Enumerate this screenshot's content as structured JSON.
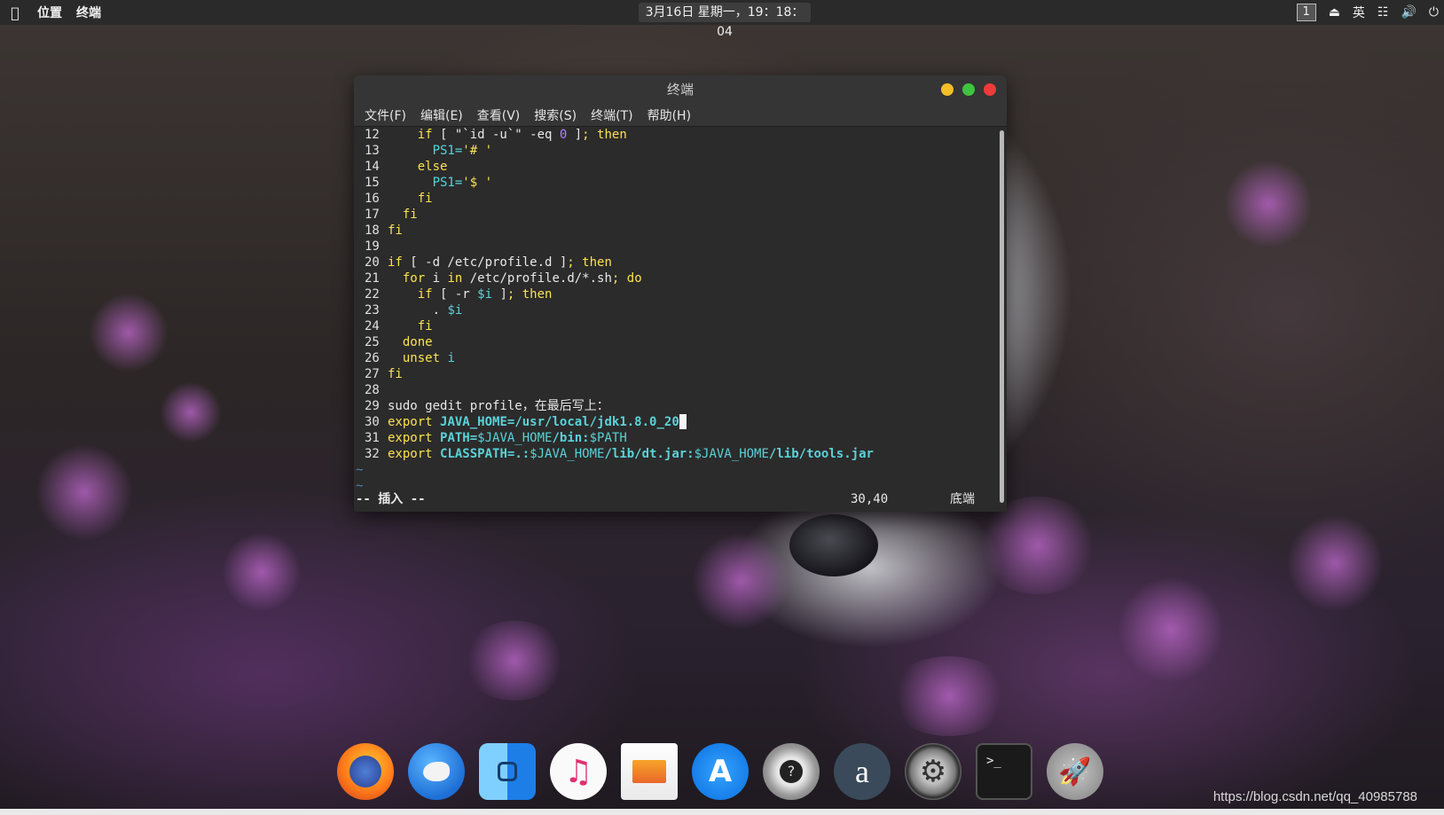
{
  "topbar": {
    "apple_icon": "apple-icon",
    "places": "位置",
    "app_name": "终端",
    "clock": "3月16日 星期一，19：18：04",
    "workspace": "1",
    "input_method": "英",
    "tray_icons": [
      "eject-icon",
      "network-icon",
      "volume-icon",
      "power-icon"
    ]
  },
  "terminal": {
    "title": "终端",
    "menu": [
      "文件(F)",
      "编辑(E)",
      "查看(V)",
      "搜索(S)",
      "终端(T)",
      "帮助(H)"
    ],
    "lines": [
      {
        "n": "12",
        "text": "    if [ \"`id -u`\" -eq 0 ]; then"
      },
      {
        "n": "13",
        "text": "      PS1='# '"
      },
      {
        "n": "14",
        "text": "    else"
      },
      {
        "n": "15",
        "text": "      PS1='$ '"
      },
      {
        "n": "16",
        "text": "    fi"
      },
      {
        "n": "17",
        "text": "  fi"
      },
      {
        "n": "18",
        "text": "fi"
      },
      {
        "n": "19",
        "text": ""
      },
      {
        "n": "20",
        "text": "if [ -d /etc/profile.d ]; then"
      },
      {
        "n": "21",
        "text": "  for i in /etc/profile.d/*.sh; do"
      },
      {
        "n": "22",
        "text": "    if [ -r $i ]; then"
      },
      {
        "n": "23",
        "text": "      . $i"
      },
      {
        "n": "24",
        "text": "    fi"
      },
      {
        "n": "25",
        "text": "  done"
      },
      {
        "n": "26",
        "text": "  unset i"
      },
      {
        "n": "27",
        "text": "fi"
      },
      {
        "n": "28",
        "text": ""
      },
      {
        "n": "29",
        "text": "sudo gedit profile，在最后写上："
      },
      {
        "n": "30",
        "text": "export JAVA_HOME=/usr/local/jdk1.8.0_20"
      },
      {
        "n": "31",
        "text": "export PATH=$JAVA_HOME/bin:$PATH"
      },
      {
        "n": "32",
        "text": "export CLASSPATH=.:$JAVA_HOME/lib/dt.jar:$JAVA_HOME/lib/tools.jar"
      }
    ],
    "tilde": "~",
    "mode": "-- 插入 --",
    "cursor_pos": "30,40",
    "scroll_pos": "底端"
  },
  "dock": {
    "apps": [
      "firefox-icon",
      "browser-eagle-icon",
      "finder-icon",
      "music-icon",
      "pages-icon",
      "app-store-icon",
      "help-icon",
      "amazon-icon",
      "settings-icon",
      "terminal-icon",
      "launchpad-icon"
    ]
  },
  "watermark": "https://blog.csdn.net/qq_40985788"
}
